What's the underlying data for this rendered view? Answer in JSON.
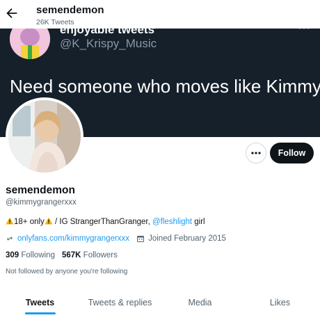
{
  "header": {
    "title": "semendemon",
    "subtitle": "26K Tweets",
    "back_icon": "arrow-left-icon"
  },
  "banner": {
    "embedded_name": "enjoyable tweets",
    "embedded_handle": "@K_Krispy_Music",
    "embedded_text": "Need someone who moves like Kimmy",
    "background_color": "#15202b"
  },
  "profile": {
    "display_name": "semendemon",
    "handle": "@kimmygrangerxxx",
    "bio": {
      "warning_icon": "warning-icon",
      "part1": "18+ only",
      "part2": " / IG StrangerThanGranger, ",
      "mention": "@fleshlight",
      "part3": " girl"
    },
    "link": "onlyfans.com/kimmygrangerxxx",
    "joined": "Joined February 2015",
    "following_count": "309",
    "following_label": "Following",
    "followers_count": "567K",
    "followers_label": "Followers",
    "not_followed": "Not followed by anyone you're following"
  },
  "actions": {
    "more_icon": "more-horizontal-icon",
    "follow_label": "Follow"
  },
  "tabs": [
    {
      "label": "Tweets",
      "active": true
    },
    {
      "label": "Tweets & replies",
      "active": false
    },
    {
      "label": "Media",
      "active": false
    },
    {
      "label": "Likes",
      "active": false
    }
  ],
  "colors": {
    "accent": "#1d9bf0",
    "text": "#0f1419",
    "muted": "#536471",
    "follow_bg": "#0f1419"
  }
}
